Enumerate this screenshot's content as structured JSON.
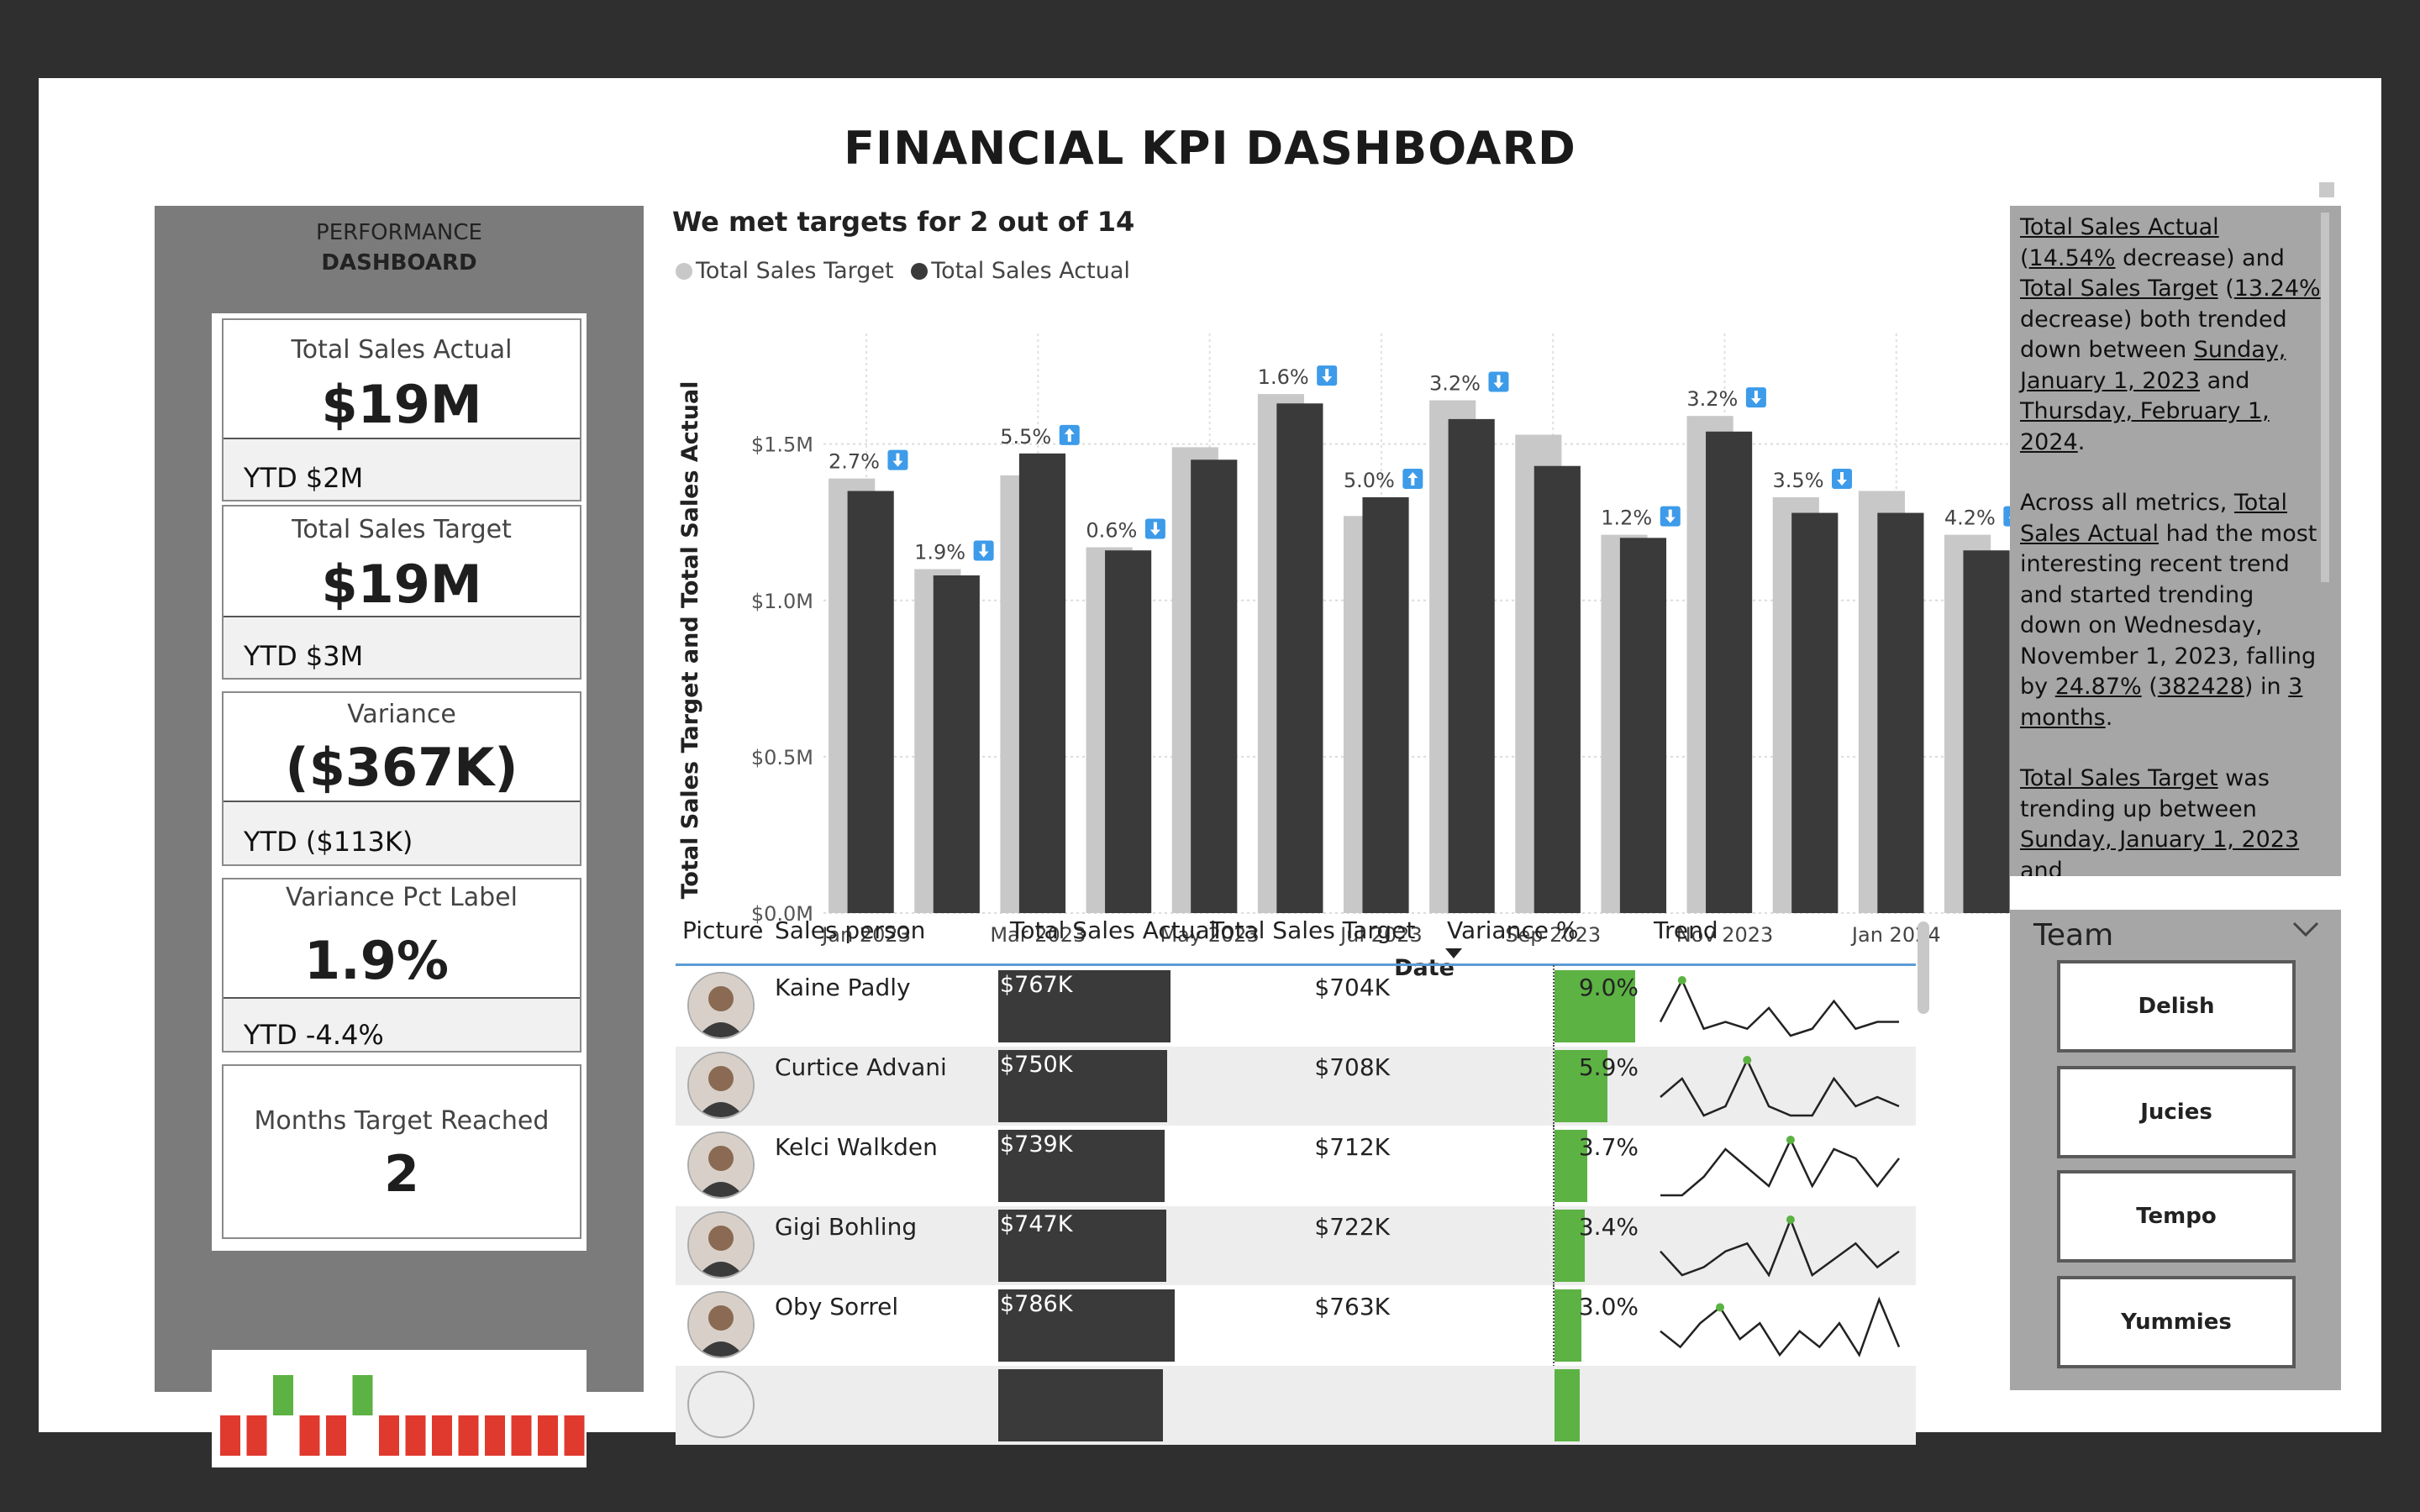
{
  "title": "FINANCIAL KPI DASHBOARD",
  "left_panel": {
    "title_line1": "PERFORMANCE",
    "title_line2": "DASHBOARD",
    "cards": [
      {
        "label": "Total Sales Actual",
        "value": "$19M",
        "ytd": "YTD $2M"
      },
      {
        "label": "Total Sales Target",
        "value": "$19M",
        "ytd": "YTD $3M"
      },
      {
        "label": "Variance",
        "value": "($367K)",
        "ytd": "YTD ($113K)"
      },
      {
        "label": "Variance Pct Label",
        "value": "1.9%",
        "ytd": "YTD -4.4%"
      },
      {
        "label": "Months Target Reached",
        "value": "2"
      }
    ],
    "mini_indicator": {
      "months_met": [
        false,
        false,
        true,
        false,
        false,
        true,
        false,
        false,
        false,
        false,
        false,
        false,
        false,
        false
      ],
      "colors": {
        "met": "#5cb243",
        "missed": "#e03a2f"
      }
    }
  },
  "chart": {
    "heading": "We met targets for 2 out of 14",
    "legend": [
      {
        "name": "Total Sales Target",
        "color": "#c8c8c8"
      },
      {
        "name": "Total Sales Actual",
        "color": "#3a3a3a"
      }
    ]
  },
  "chart_data": {
    "type": "bar",
    "title": "We met targets for 2 out of 14",
    "xlabel": "Date",
    "ylabel": "Total Sales Target and Total Sales Actual",
    "ylim": [
      0,
      1.8
    ],
    "y_ticks": [
      "$0.0M",
      "$0.5M",
      "$1.0M",
      "$1.5M"
    ],
    "y_tick_values": [
      0,
      0.5,
      1.0,
      1.5
    ],
    "x_tick_labels": [
      "Jan 2023",
      "Mar 2023",
      "May 2023",
      "Jul 2023",
      "Sep 2023",
      "Nov 2023",
      "Jan 2024"
    ],
    "x_tick_index": [
      0,
      2,
      4,
      6,
      8,
      10,
      12
    ],
    "categories": [
      "2023-01",
      "2023-02",
      "2023-03",
      "2023-04",
      "2023-05",
      "2023-06",
      "2023-07",
      "2023-08",
      "2023-09",
      "2023-10",
      "2023-11",
      "2023-12",
      "2024-01",
      "2024-02"
    ],
    "series": [
      {
        "name": "Total Sales Target",
        "values": [
          1.39,
          1.1,
          1.4,
          1.17,
          1.49,
          1.66,
          1.27,
          1.64,
          1.53,
          1.21,
          1.59,
          1.33,
          1.35,
          1.21
        ]
      },
      {
        "name": "Total Sales Actual",
        "values": [
          1.35,
          1.08,
          1.47,
          1.16,
          1.45,
          1.63,
          1.33,
          1.58,
          1.43,
          1.2,
          1.54,
          1.28,
          1.28,
          1.16
        ]
      }
    ],
    "data_labels": [
      "2.7%",
      "1.9%",
      "5.5%",
      "0.6%",
      "",
      "1.6%",
      "5.0%",
      "3.2%",
      "",
      "1.2%",
      "3.2%",
      "3.5%",
      "",
      "4.2%"
    ],
    "label_direction": [
      "down",
      "down",
      "up",
      "down",
      "",
      "down",
      "up",
      "down",
      "",
      "down",
      "down",
      "down",
      "",
      "down"
    ],
    "label_icon_color": "#3d9be9",
    "grid": true
  },
  "table": {
    "headers": [
      "Picture",
      "Sales person",
      "Total Sales Actual",
      "Total Sales Target",
      "Variance %",
      "Trend"
    ],
    "sort_icon": "sort-desc-icon",
    "rows": [
      {
        "name": "Kaine Padly",
        "actual": "$767K",
        "actual_value": 767,
        "target": "$704K",
        "variance": "9.0%",
        "variance_value": 9.0,
        "trend": [
          3,
          9,
          2,
          3,
          2,
          5,
          1,
          2,
          6,
          2,
          3,
          3
        ],
        "peak": 1
      },
      {
        "name": "Curtice Advani",
        "actual": "$750K",
        "actual_value": 750,
        "target": "$708K",
        "variance": "5.9%",
        "variance_value": 5.9,
        "trend": [
          4,
          6,
          2,
          3,
          8,
          3,
          2,
          2,
          6,
          3,
          4,
          3
        ],
        "peak": 4
      },
      {
        "name": "Kelci Walkden",
        "actual": "$739K",
        "actual_value": 739,
        "target": "$712K",
        "variance": "3.7%",
        "variance_value": 3.7,
        "trend": [
          2,
          2,
          4,
          7,
          5,
          3,
          8,
          3,
          7,
          6,
          3,
          6
        ],
        "peak": 6
      },
      {
        "name": "Gigi Bohling",
        "actual": "$747K",
        "actual_value": 747,
        "target": "$722K",
        "variance": "3.4%",
        "variance_value": 3.4,
        "trend": [
          5,
          2,
          3,
          5,
          6,
          2,
          9,
          2,
          4,
          6,
          3,
          5
        ],
        "peak": 6
      },
      {
        "name": "Oby Sorrel",
        "actual": "$786K",
        "actual_value": 786,
        "target": "$763K",
        "variance": "3.0%",
        "variance_value": 3.0,
        "trend": [
          5,
          3,
          6,
          8,
          4,
          6,
          2,
          5,
          3,
          6,
          2,
          9,
          3
        ],
        "peak": 3
      }
    ],
    "colors": {
      "actual_bar": "#3a3a3a",
      "variance_bar": "#5cb243",
      "trend_peak": "#5cb243"
    }
  },
  "narrative": {
    "paragraphs": [
      [
        {
          "t": "Total Sales Actual",
          "u": true
        },
        {
          "t": " ("
        },
        {
          "t": "14.54%",
          "u": true
        },
        {
          "t": " decrease) and "
        },
        {
          "t": "Total Sales Target",
          "u": true
        },
        {
          "t": " ("
        },
        {
          "t": "13.24%",
          "u": true
        },
        {
          "t": " decrease) both trended down between "
        },
        {
          "t": "Sunday, January 1, 2023",
          "u": true
        },
        {
          "t": " and "
        },
        {
          "t": "Thursday, February 1, 2024",
          "u": true
        },
        {
          "t": "."
        }
      ],
      [
        {
          "t": "Across all metrics, "
        },
        {
          "t": "Total Sales Actual",
          "u": true
        },
        {
          "t": " had the most interesting recent trend and started trending down on Wednesday, November 1, 2023"
        },
        {
          "t": ", falling by "
        },
        {
          "t": "24.87%",
          "u": true
        },
        {
          "t": " ("
        },
        {
          "t": "382428",
          "u": true
        },
        {
          "t": ") in "
        },
        {
          "t": "3",
          "u": true
        },
        {
          "t": " "
        },
        {
          "t": "months",
          "u": true
        },
        {
          "t": "."
        }
      ],
      [
        {
          "t": "Total Sales Target",
          "u": true
        },
        {
          "t": " was trending up between "
        },
        {
          "t": "Sunday, January 1, 2023",
          "u": true
        },
        {
          "t": " and"
        }
      ]
    ]
  },
  "team": {
    "title": "Team",
    "options": [
      "Delish",
      "Jucies",
      "Tempo",
      "Yummies"
    ]
  }
}
